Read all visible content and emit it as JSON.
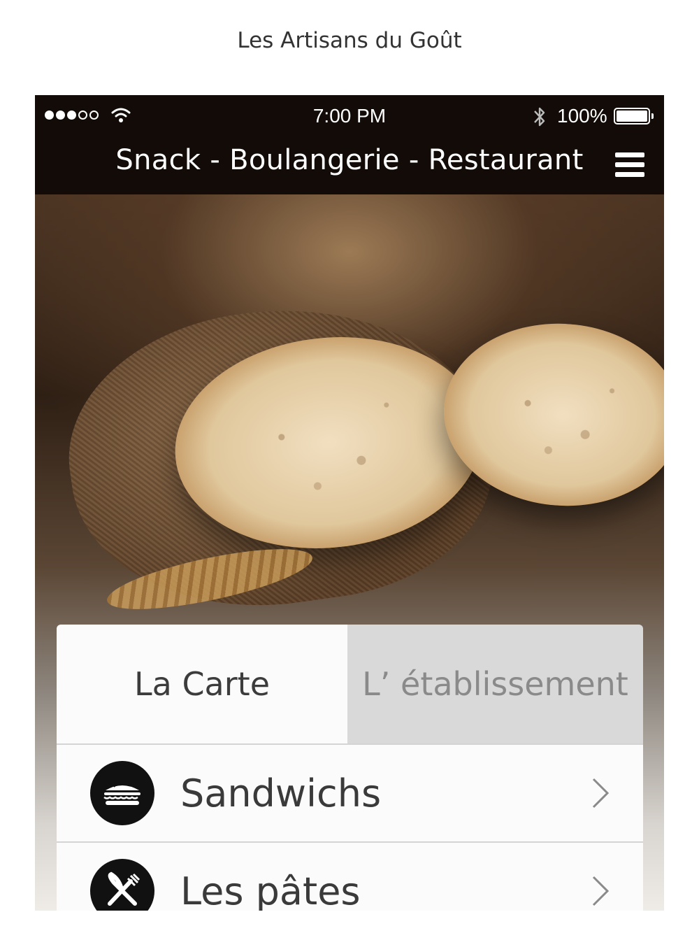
{
  "caption": "Les Artisans du Goût",
  "status_bar": {
    "time": "7:00 PM",
    "battery": "100%",
    "signal_bars_filled": 3,
    "signal_bars_total": 5
  },
  "nav": {
    "title": "Snack - Boulangerie - Restaurant"
  },
  "tabs": [
    {
      "label": "La Carte",
      "active": true
    },
    {
      "label": "L’ établissement",
      "active": false
    }
  ],
  "list": [
    {
      "label": "Sandwichs",
      "icon": "sandwich-icon"
    },
    {
      "label": "Les pâtes",
      "icon": "fork-knife-icon"
    }
  ],
  "colors": {
    "topbar": "#120b07",
    "tab_active": "#fbfbfb",
    "tab_inactive": "#d9d9d9",
    "icon_circle": "#111111"
  }
}
